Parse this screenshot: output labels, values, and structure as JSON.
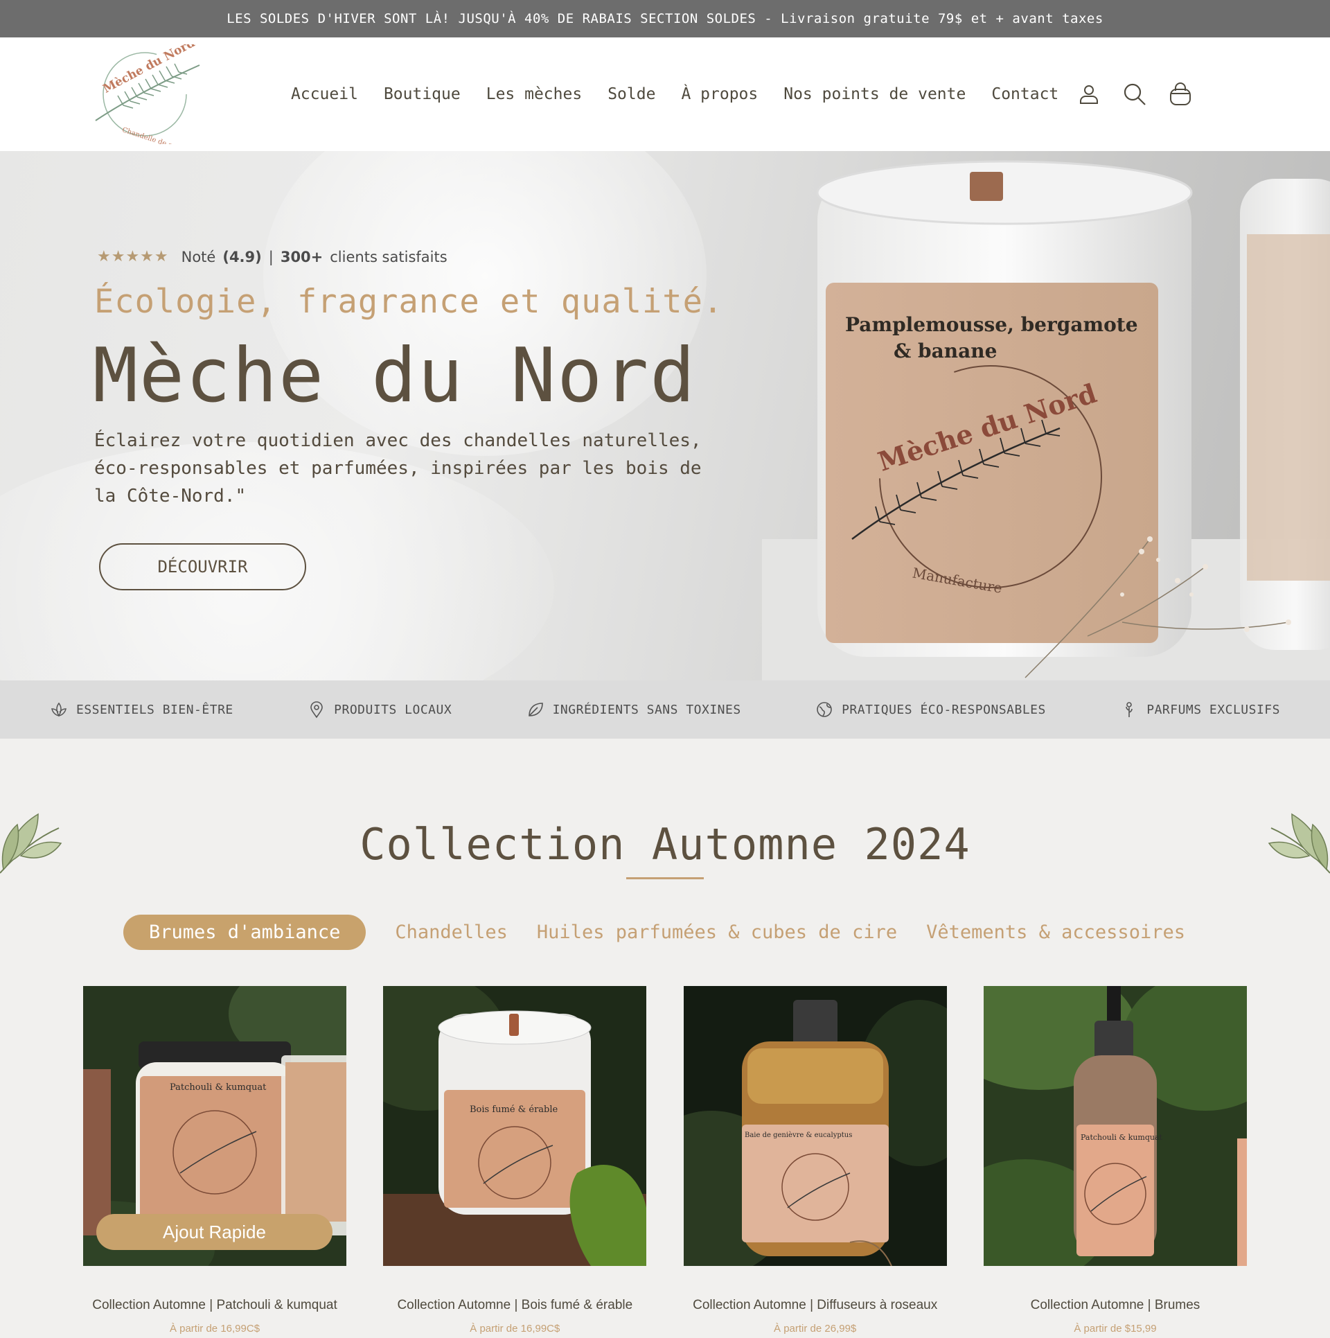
{
  "announcement": "LES SOLDES D'HIVER SONT LÀ! JUSQU'À 40% DE RABAIS SECTION SOLDES - Livraison gratuite 79$ et + avant taxes",
  "logo": {
    "name": "Mèche du Nord",
    "sub": "Chandelle de soya"
  },
  "nav": [
    "Accueil",
    "Boutique",
    "Les mèches",
    "Solde",
    "À propos",
    "Nos points de vente",
    "Contact"
  ],
  "header_icons": [
    "account-icon",
    "search-icon",
    "cart-icon"
  ],
  "hero": {
    "rating_stars": 5,
    "rating_label": "Noté",
    "rating_value": "(4.9)",
    "separator": "|",
    "clients_count": "300+",
    "clients_label": "clients satisfaits",
    "tagline": "Écologie, fragrance et qualité.",
    "title": "Mèche du Nord",
    "description": "Éclairez votre quotidien avec des chandelles naturelles, éco-responsables et parfumées, inspirées par les bois de la Côte-Nord.\"",
    "cta": "DÉCOUVRIR",
    "jar_label_line1": "Pamplemousse, bergamote",
    "jar_label_line2": "& banane",
    "jar_brand": "Mèche du Nord",
    "jar_sub": "Manufacture"
  },
  "features": [
    {
      "icon": "lotus-icon",
      "label": "ESSENTIELS BIEN-ÊTRE"
    },
    {
      "icon": "location-pin-icon",
      "label": "PRODUITS LOCAUX"
    },
    {
      "icon": "leaf-icon",
      "label": "INGRÉDIENTS SANS TOXINES"
    },
    {
      "icon": "globe-icon",
      "label": "PRATIQUES ÉCO-RESPONSABLES"
    },
    {
      "icon": "flower-icon",
      "label": "PARFUMS EXCLUSIFS"
    }
  ],
  "collection": {
    "title": "Collection Automne 2024",
    "tabs": [
      "Brumes d'ambiance",
      "Chandelles",
      "Huiles parfumées & cubes de cire",
      "Vêtements & accessoires"
    ],
    "active_tab": 0,
    "quick_add": "Ajout Rapide",
    "products": [
      {
        "name": "Collection Automne | Patchouli & kumquat",
        "price": "À partir de 16,99C$",
        "label": "Patchouli & kumquat"
      },
      {
        "name": "Collection Automne | Bois fumé & érable",
        "price": "À partir de 16,99C$",
        "label": "Bois fumé & érable"
      },
      {
        "name": "Collection Automne | Diffuseurs à roseaux",
        "price": "À partir de 26,99$",
        "label": "Baie de genièvre & eucalyptus"
      },
      {
        "name": "Collection Automne | Brumes",
        "price": "À partir de $15,99",
        "label": "Patchouli & kumquat"
      }
    ]
  },
  "colors": {
    "accent": "#c8a26c",
    "brown": "#5d5140",
    "announce_bg": "#6d6d6d",
    "feature_bg": "#dcdcdc",
    "page_bg": "#f1f0ee"
  }
}
